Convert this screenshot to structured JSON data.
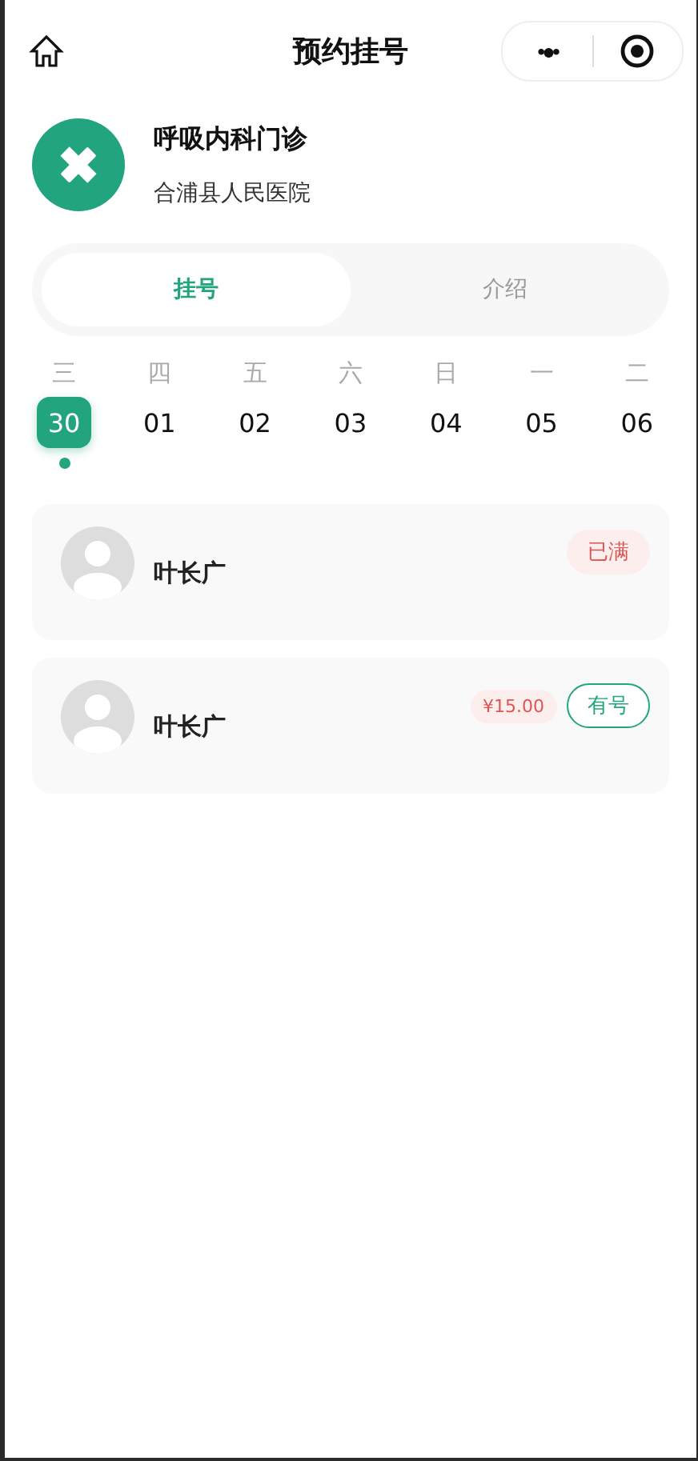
{
  "nav": {
    "title": "预约挂号",
    "menu_glyph": "•●•"
  },
  "department": {
    "name": "呼吸内科门诊",
    "hospital": "合浦县人民医院"
  },
  "tabs": [
    {
      "label": "挂号",
      "selected": true
    },
    {
      "label": "介绍",
      "selected": false
    }
  ],
  "dates": [
    {
      "weekday": "三",
      "day": "30",
      "selected": true
    },
    {
      "weekday": "四",
      "day": "01",
      "selected": false
    },
    {
      "weekday": "五",
      "day": "02",
      "selected": false
    },
    {
      "weekday": "六",
      "day": "03",
      "selected": false
    },
    {
      "weekday": "日",
      "day": "04",
      "selected": false
    },
    {
      "weekday": "一",
      "day": "05",
      "selected": false
    },
    {
      "weekday": "二",
      "day": "06",
      "selected": false
    }
  ],
  "doctors": [
    {
      "name": "叶长广",
      "kind": "full",
      "status": "已满"
    },
    {
      "name": "叶长广",
      "kind": "available",
      "price": "¥15.00",
      "status": "有号"
    }
  ]
}
